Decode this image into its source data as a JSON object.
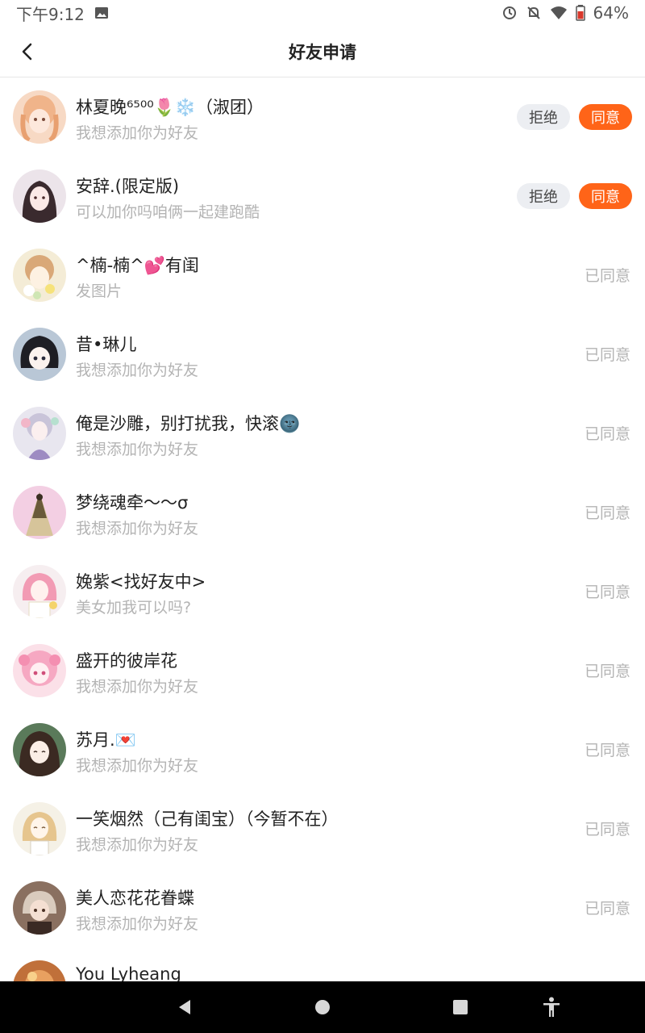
{
  "status_bar": {
    "time": "下午9:12",
    "battery": "64%"
  },
  "header": {
    "title": "好友申请"
  },
  "requests": [
    {
      "name": "林夏晚⁶⁵⁰⁰🌷❄️（淑团）",
      "message": "我想添加你为好友",
      "reject_label": "拒绝",
      "accept_label": "同意",
      "status": ""
    },
    {
      "name": "安辞.(限定版)",
      "message": "可以加你吗咱俩一起建跑酷",
      "reject_label": "拒绝",
      "accept_label": "同意",
      "status": ""
    },
    {
      "name": "^楠-楠^💕有闺",
      "message": "发图片",
      "status": "已同意"
    },
    {
      "name": "昔•琳儿",
      "message": "我想添加你为好友",
      "status": "已同意"
    },
    {
      "name": "俺是沙雕，别打扰我，快滚🌚",
      "message": "我想添加你为好友",
      "status": "已同意"
    },
    {
      "name": "梦绕魂牵～～σ",
      "message": "我想添加你为好友",
      "status": "已同意"
    },
    {
      "name": "婏紫<找好友中>",
      "message": "美女加我可以吗?",
      "status": "已同意"
    },
    {
      "name": "盛开的彼岸花",
      "message": "我想添加你为好友",
      "status": "已同意"
    },
    {
      "name": "苏月.💌",
      "message": "我想添加你为好友",
      "status": "已同意"
    },
    {
      "name": "一笑烟然（己有闺宝）（今暂不在）",
      "message": "我想添加你为好友",
      "status": "已同意"
    },
    {
      "name": "美人恋花花眷蝶",
      "message": "我想添加你为好友",
      "status": "已同意"
    },
    {
      "name": "You Lyheang",
      "message": "",
      "status": ""
    }
  ],
  "colors": {
    "accent": "#ff6418",
    "muted_text": "#b4b4b4",
    "reject_bg": "#eceef2"
  }
}
